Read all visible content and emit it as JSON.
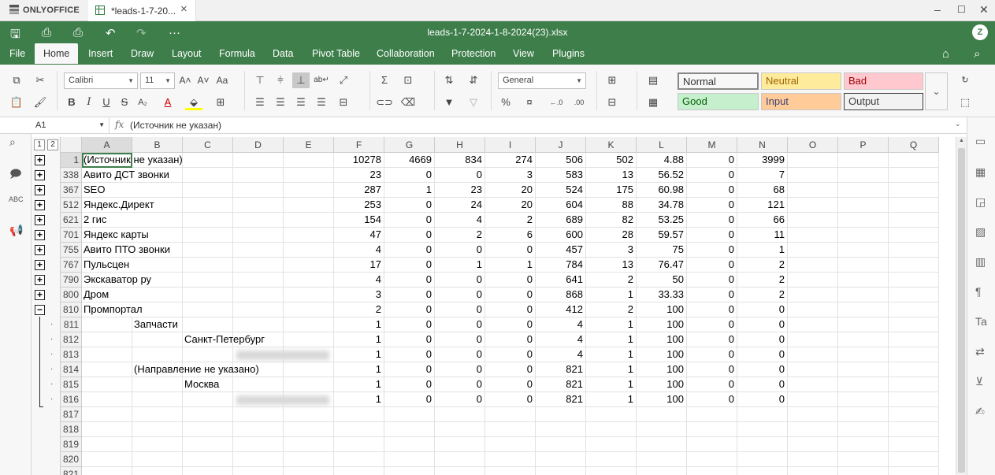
{
  "app": {
    "brand": "ONLYOFFICE",
    "tab_title": "*leads-1-7-20...",
    "doc_title": "leads-1-7-2024-1-8-2024(23).xlsx",
    "avatar": "Z"
  },
  "menu": [
    "File",
    "Home",
    "Insert",
    "Draw",
    "Layout",
    "Formula",
    "Data",
    "Pivot Table",
    "Collaboration",
    "Protection",
    "View",
    "Plugins"
  ],
  "active_menu": "Home",
  "ribbon": {
    "font": "Calibri",
    "size": "11",
    "number_format": "General"
  },
  "styles": [
    {
      "label": "Normal",
      "bg": "#ffffff",
      "fg": "#000000"
    },
    {
      "label": "Neutral",
      "bg": "#ffeb9c",
      "fg": "#9c6500"
    },
    {
      "label": "Bad",
      "bg": "#ffc7ce",
      "fg": "#9c0006"
    },
    {
      "label": "Good",
      "bg": "#c6efce",
      "fg": "#006100"
    },
    {
      "label": "Input",
      "bg": "#ffcc99",
      "fg": "#3f3f76"
    },
    {
      "label": "Output",
      "bg": "#f2f2f2",
      "fg": "#3f3f3f"
    }
  ],
  "formula": {
    "name_box": "A1",
    "fx": "fx",
    "value": "(Источник не указан)"
  },
  "outline_levels": [
    "1",
    "2"
  ],
  "columns": [
    "A",
    "B",
    "C",
    "D",
    "E",
    "F",
    "G",
    "H",
    "I",
    "J",
    "K",
    "L",
    "M",
    "N",
    "O",
    "P",
    "Q"
  ],
  "rows": [
    {
      "n": "1",
      "a": "(Источник не указан)",
      "v": [
        "10278",
        "4669",
        "834",
        "274",
        "506",
        "502",
        "4.88",
        "0",
        "3999"
      ]
    },
    {
      "n": "338",
      "a": "Авито ДСТ звонки",
      "v": [
        "23",
        "0",
        "0",
        "3",
        "583",
        "13",
        "56.52",
        "0",
        "7"
      ]
    },
    {
      "n": "367",
      "a": "SEO",
      "v": [
        "287",
        "1",
        "23",
        "20",
        "524",
        "175",
        "60.98",
        "0",
        "68"
      ]
    },
    {
      "n": "512",
      "a": "Яндекс.Директ",
      "v": [
        "253",
        "0",
        "24",
        "20",
        "604",
        "88",
        "34.78",
        "0",
        "121"
      ]
    },
    {
      "n": "621",
      "a": "2 гис",
      "v": [
        "154",
        "0",
        "4",
        "2",
        "689",
        "82",
        "53.25",
        "0",
        "66"
      ]
    },
    {
      "n": "701",
      "a": "Яндекс карты",
      "v": [
        "47",
        "0",
        "2",
        "6",
        "600",
        "28",
        "59.57",
        "0",
        "11"
      ]
    },
    {
      "n": "755",
      "a": "Авито ПТО звонки",
      "v": [
        "4",
        "0",
        "0",
        "0",
        "457",
        "3",
        "75",
        "0",
        "1"
      ]
    },
    {
      "n": "767",
      "a": "Пульсцен",
      "v": [
        "17",
        "0",
        "1",
        "1",
        "784",
        "13",
        "76.47",
        "0",
        "2"
      ]
    },
    {
      "n": "790",
      "a": "Экскаватор ру",
      "v": [
        "4",
        "0",
        "0",
        "0",
        "641",
        "2",
        "50",
        "0",
        "2"
      ]
    },
    {
      "n": "800",
      "a": "Дром",
      "v": [
        "3",
        "0",
        "0",
        "0",
        "868",
        "1",
        "33.33",
        "0",
        "2"
      ]
    },
    {
      "n": "810",
      "a": "Промпортал",
      "v": [
        "2",
        "0",
        "0",
        "0",
        "412",
        "2",
        "100",
        "0",
        "0"
      ]
    },
    {
      "n": "811",
      "b": "Запчасти",
      "v": [
        "1",
        "0",
        "0",
        "0",
        "4",
        "1",
        "100",
        "0",
        "0"
      ]
    },
    {
      "n": "812",
      "c": "Санкт-Петербург",
      "v": [
        "1",
        "0",
        "0",
        "0",
        "4",
        "1",
        "100",
        "0",
        "0"
      ]
    },
    {
      "n": "813",
      "v": [
        "1",
        "0",
        "0",
        "0",
        "4",
        "1",
        "100",
        "0",
        "0"
      ]
    },
    {
      "n": "814",
      "b": "(Направление не указано)",
      "v": [
        "1",
        "0",
        "0",
        "0",
        "821",
        "1",
        "100",
        "0",
        "0"
      ]
    },
    {
      "n": "815",
      "c": "Москва",
      "v": [
        "1",
        "0",
        "0",
        "0",
        "821",
        "1",
        "100",
        "0",
        "0"
      ]
    },
    {
      "n": "816",
      "v": [
        "1",
        "0",
        "0",
        "0",
        "821",
        "1",
        "100",
        "0",
        "0"
      ]
    },
    {
      "n": "817",
      "v": []
    },
    {
      "n": "818",
      "v": []
    },
    {
      "n": "819",
      "v": []
    },
    {
      "n": "820",
      "v": []
    },
    {
      "n": "821",
      "v": []
    }
  ]
}
